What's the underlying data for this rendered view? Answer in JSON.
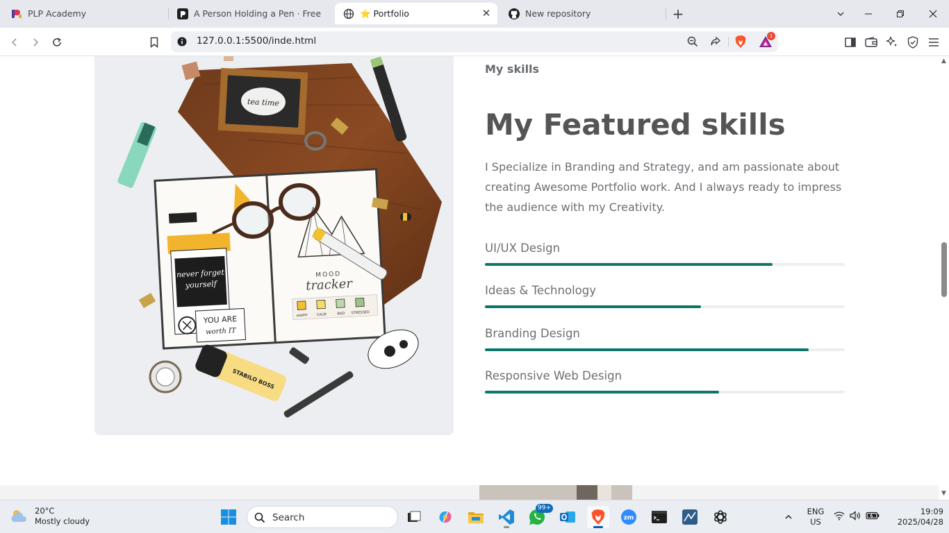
{
  "browser": {
    "tabs": [
      {
        "title": "PLP Academy",
        "icon": "plp-logo-icon",
        "active": false
      },
      {
        "title": "A Person Holding a Pen · Free Stock",
        "icon": "pexels-logo-icon",
        "active": false
      },
      {
        "title": "⭐ Portfolio",
        "icon": "globe-icon",
        "active": true
      },
      {
        "title": "New repository",
        "icon": "github-icon",
        "active": false
      }
    ],
    "new_tab_icon": "plus-icon",
    "url": "127.0.0.1:5500/inde.html",
    "shields_badge": "1"
  },
  "page": {
    "subtitle": "My skills",
    "heading": "My Featured skills",
    "description": "I Specialize in Branding and Strategy, and am passionate about creating Awesome Portfolio work. And I always ready to impress the audience with my Creativity.",
    "skills": [
      {
        "name": "UI/UX Design",
        "level": 0.8
      },
      {
        "name": "Ideas & Technology",
        "level": 0.6
      },
      {
        "name": "Branding Design",
        "level": 0.9
      },
      {
        "name": "Responsive Web Design",
        "level": 0.65
      }
    ],
    "accent_color": "#0a7769",
    "track_color": "#eeeeee"
  },
  "photo_art": {
    "tag_1": "MOOD",
    "tag_2": "tracker",
    "mood_labels": [
      "HAPPY",
      "CALM",
      "BAD",
      "STRESSED"
    ],
    "note_1": "never forget yourself",
    "note_2": "YOU ARE worth IT",
    "highlighter_brand": "STABILO BOSS",
    "frame_text": "tea time"
  },
  "taskbar": {
    "weather_temp": "20°C",
    "weather_desc": "Mostly cloudy",
    "search_placeholder": "Search",
    "whatsapp_badge": "99+",
    "language": "ENG",
    "region": "US",
    "time": "19:09",
    "date": "2025/04/28"
  }
}
